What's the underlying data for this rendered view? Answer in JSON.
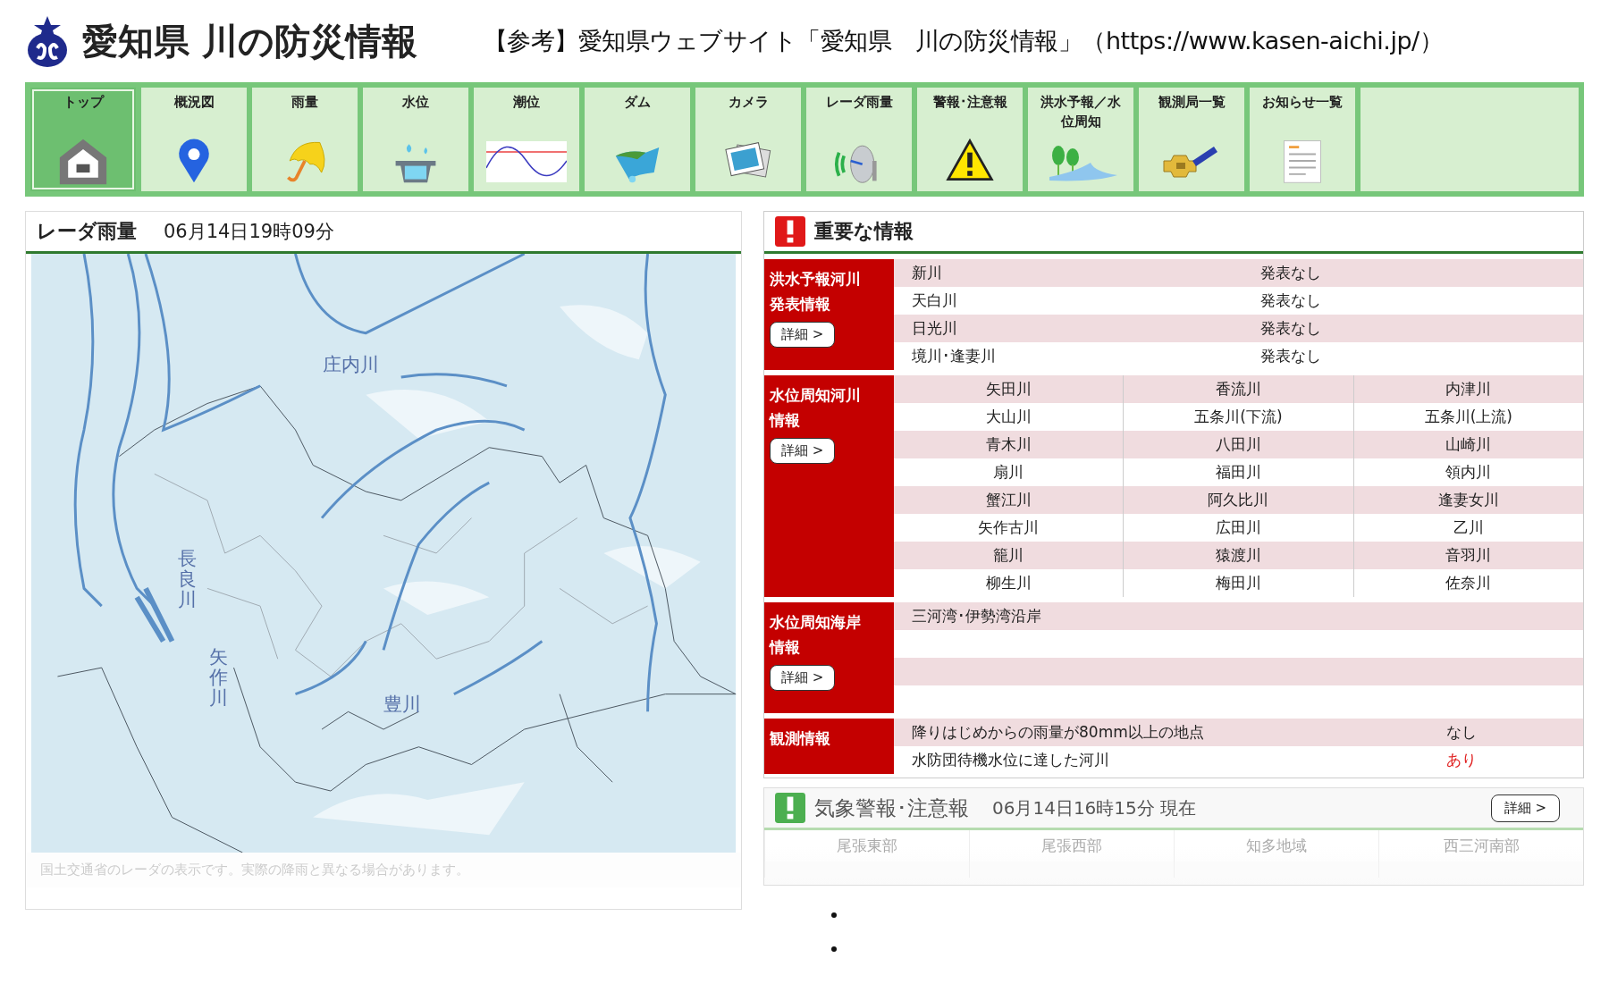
{
  "header": {
    "title": "愛知県 川の防災情報",
    "reference": "【参考】愛知県ウェブサイト「愛知県　川の防災情報」（https://www.kasen-aichi.jp/）"
  },
  "nav": [
    {
      "label": "トップ",
      "selected": true
    },
    {
      "label": "概況図",
      "selected": false
    },
    {
      "label": "雨量",
      "selected": false
    },
    {
      "label": "水位",
      "selected": false
    },
    {
      "label": "潮位",
      "selected": false
    },
    {
      "label": "ダム",
      "selected": false
    },
    {
      "label": "カメラ",
      "selected": false
    },
    {
      "label": "レーダ雨量",
      "selected": false
    },
    {
      "label": "警報･注意報",
      "selected": false
    },
    {
      "label": "洪水予報／水位周知",
      "selected": false
    },
    {
      "label": "観測局一覧",
      "selected": false
    },
    {
      "label": "お知らせ一覧",
      "selected": false
    }
  ],
  "radar": {
    "title": "レーダ雨量",
    "time": "06月14日19時09分",
    "map_labels": [
      "庄内川",
      "長良川",
      "矢作川",
      "豊川"
    ],
    "note": "国土交通省のレーダの表示です。実際の降雨と異なる場合があります。"
  },
  "important": {
    "title": "重要な情報",
    "sections": [
      {
        "kind": "status",
        "label": "洪水予報河川発表情報",
        "button": "詳細 >",
        "rows": [
          [
            "新川",
            "発表なし"
          ],
          [
            "天白川",
            "発表なし"
          ],
          [
            "日光川",
            "発表なし"
          ],
          [
            "境川･逢妻川",
            "発表なし"
          ]
        ]
      },
      {
        "kind": "grid",
        "label": "水位周知河川情報",
        "button": "詳細 >",
        "rows": [
          [
            "矢田川",
            "香流川",
            "内津川"
          ],
          [
            "大山川",
            "五条川(下流)",
            "五条川(上流)"
          ],
          [
            "青木川",
            "八田川",
            "山崎川"
          ],
          [
            "扇川",
            "福田川",
            "領内川"
          ],
          [
            "蟹江川",
            "阿久比川",
            "逢妻女川"
          ],
          [
            "矢作古川",
            "広田川",
            "乙川"
          ],
          [
            "籠川",
            "猿渡川",
            "音羽川"
          ],
          [
            "柳生川",
            "梅田川",
            "佐奈川"
          ]
        ]
      },
      {
        "kind": "coast",
        "label": "水位周知海岸情報",
        "button": "詳細 >",
        "rows": [
          [
            "三河湾･伊勢湾沿岸"
          ]
        ]
      },
      {
        "kind": "obs",
        "label": "観測情報",
        "rows": [
          {
            "text": "降りはじめからの雨量が80mm以上の地点",
            "value": "なし",
            "alert": false
          },
          {
            "text": "水防団待機水位に達した河川",
            "value": "あり",
            "alert": true
          }
        ]
      }
    ]
  },
  "weather": {
    "title": "気象警報･注意報",
    "time": "06月14日16時15分 現在",
    "button": "詳細 >",
    "regions": [
      "尾張東部",
      "尾張西部",
      "知多地域",
      "西三河南部"
    ]
  }
}
